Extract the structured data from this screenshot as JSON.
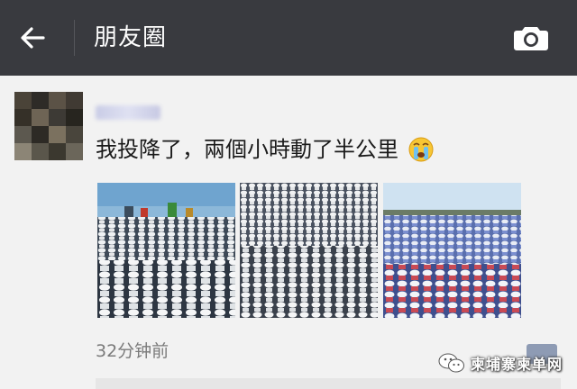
{
  "header": {
    "title": "朋友圈",
    "background": "#393a3f"
  },
  "post": {
    "text": "我投降了，兩個小時動了半公里",
    "emoji": "crying-face-icon",
    "timestamp": "32分钟前",
    "photos": [
      {
        "name": "crowd-photo-1"
      },
      {
        "name": "crowd-photo-2"
      },
      {
        "name": "crowd-photo-3"
      }
    ]
  },
  "watermark": {
    "text": "柬埔寨柬单网"
  },
  "colors": {
    "header_bg": "#393a3f",
    "page_bg": "#f2f2f2",
    "text": "#1a1a1a",
    "timestamp": "#7b7b7b"
  }
}
